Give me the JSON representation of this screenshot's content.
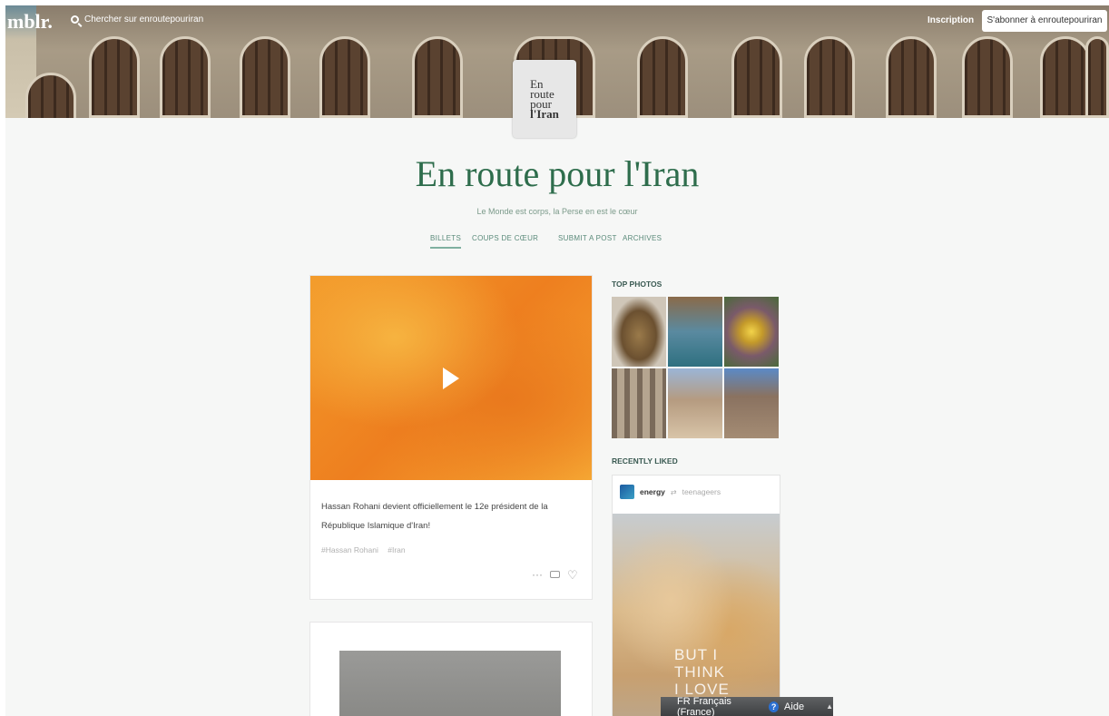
{
  "header": {
    "logo": "mblr.",
    "search_placeholder": "Chercher sur enroutepouriran",
    "signup": "Inscription",
    "follow": "S'abonner à enroutepouriran"
  },
  "avatar": {
    "line1": "En",
    "line2": "route",
    "line3": "pour",
    "line4": "l'Iran"
  },
  "blog": {
    "title": "En route pour l'Iran",
    "tagline": "Le Monde est corps, la Perse en est le cœur"
  },
  "nav": [
    "BILLETS",
    "COUPS DE CŒUR",
    "SUBMIT A POST",
    "ARCHIVES"
  ],
  "post": {
    "text": "Hassan Rohani devient officiellement le 12e président de la République Islamique d'Iran!",
    "tags": [
      "#Hassan Rohani",
      "#Iran"
    ]
  },
  "sidebar": {
    "top_photos": "TOP PHOTOS",
    "recently_liked": "RECENTLY LIKED",
    "liked_user": "energy",
    "liked_from": "teenageers",
    "liked_caption_line1": "BUT I",
    "liked_caption_line2": "THINK",
    "liked_caption_line3": "I LOVE"
  },
  "lang_bar": {
    "language": "FR Français (France)",
    "help": "Aide"
  }
}
